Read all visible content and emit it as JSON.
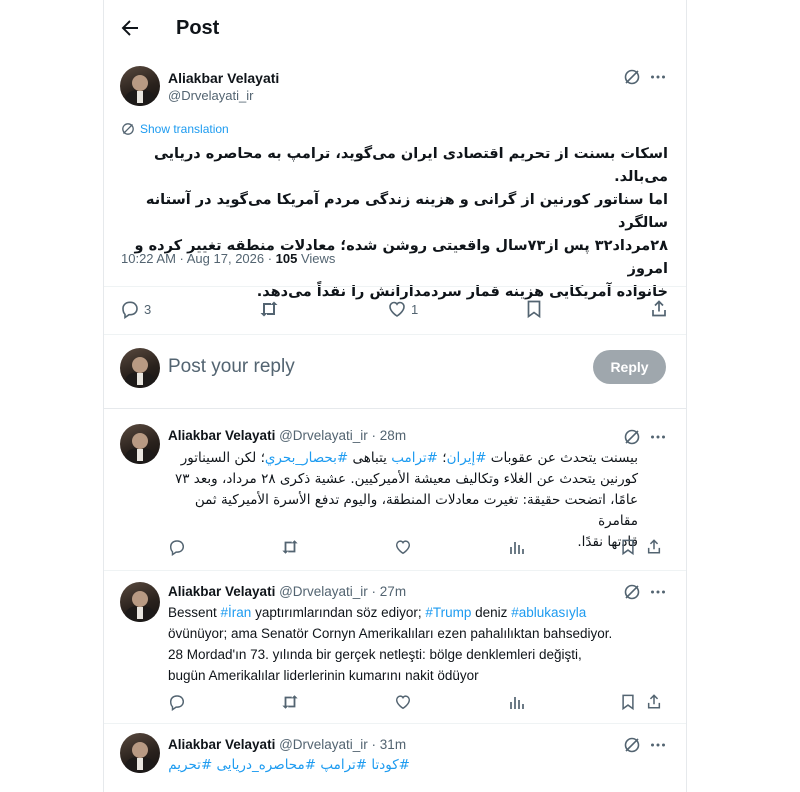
{
  "header": {
    "back_icon": "arrow-left-icon",
    "title": "Post"
  },
  "main_post": {
    "author_name": "Aliakbar Velayati",
    "author_handle": "@Drvelayati_ir",
    "show_translation": "Show translation",
    "text_line_1": "اسکات بسنت از تحریم اقتصادی ایران می‌گوید، ترامپ به محاصره دریایی می‌بالد.",
    "text_line_2": "اما سناتور کورنین از گرانی و هزینه زندگی مردم آمریکا می‌گوید در آستانه سالگرد",
    "text_line_3": "۲۸مرداد۳۲ پس از۷۳سال واقعیتی روشن شده؛ معادلات منطقه تغییر کرده و امروز",
    "text_line_4": "خانواده آمریکایی هزینه قمار سردمدارانش را نقداً می‌دهد.",
    "time": "10:22 AM · Aug 17, 2026 · ",
    "views_count": "105",
    "views_label": " Views",
    "reply_count": "3",
    "like_count": "1"
  },
  "composer": {
    "placeholder": "Post your reply",
    "reply_button": "Reply"
  },
  "replies": [
    {
      "author_name": "Aliakbar Velayati",
      "author_meta": " @Drvelayati_ir · 28m",
      "line_1_pre": "بیسنت یتحدث عن عقوبات ",
      "tag_1": "#إيران",
      "line_1_mid": "؛ ",
      "tag_2": "#ترامب",
      "line_1_mid2": " يتباهى ",
      "tag_3": "#بحصار_بحري",
      "line_1_post": "؛ لكن السيناتور",
      "line_2": "كورنين يتحدث عن الغلاء وتكاليف معيشة الأميركيين. عشية ذكرى ٢٨ مرداد، وبعد ٧٣",
      "line_3": "عامًا، اتضحت حقيقة: تغيرت معادلات المنطقة، واليوم تدفع الأسرة الأميركية ثمن مقامرة",
      "line_4": "قادتها نقدًا."
    },
    {
      "author_name": "Aliakbar Velayati",
      "author_meta": " @Drvelayati_ir · 27m",
      "line_1_pre": "Bessent ",
      "tag_1": "#İran",
      "line_1_mid": " yaptırımlarından söz ediyor; ",
      "tag_2": "#Trump",
      "line_1_mid2": " deniz ",
      "tag_3": "#ablukasıyla",
      "line_2": "övünüyor; ama Senatör Cornyn Amerikalıları ezen pahalılıktan bahsediyor.",
      "line_3": "28 Mordad'ın 73. yılında bir gerçek netleşti: bölge denklemleri değişti,",
      "line_4": "bugün Amerikalılar liderlerinin kumarını nakit ödüyor"
    },
    {
      "author_name": "Aliakbar Velayati",
      "author_meta": " @Drvelayati_ir · 31m",
      "tags_line": "#کودتا #ترامپ #محاصره_دریایی #تحریم"
    }
  ]
}
